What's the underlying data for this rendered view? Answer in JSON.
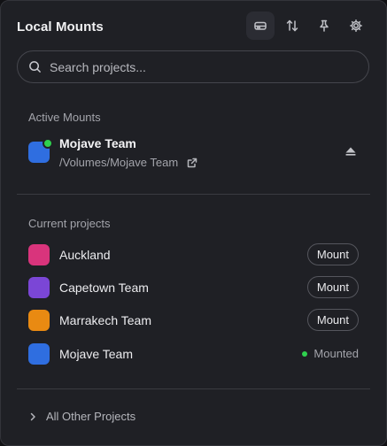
{
  "header": {
    "title": "Local Mounts",
    "icons": [
      "drive-icon",
      "sort-icon",
      "pin-icon",
      "gear-icon"
    ]
  },
  "search": {
    "placeholder": "Search projects..."
  },
  "active_mounts": {
    "label": "Active Mounts",
    "item": {
      "name": "Mojave Team",
      "path": "/Volumes/Mojave Team",
      "color": "#2f6ee0",
      "status": "mounted"
    }
  },
  "current_projects": {
    "label": "Current projects",
    "items": [
      {
        "name": "Auckland",
        "color": "#d9347c",
        "action": "Mount"
      },
      {
        "name": "Capetown Team",
        "color": "#7b46d6",
        "action": "Mount"
      },
      {
        "name": "Marrakech Team",
        "color": "#e98a12",
        "action": "Mount"
      },
      {
        "name": "Mojave Team",
        "color": "#2f6ee0",
        "status": "Mounted"
      }
    ]
  },
  "footer": {
    "label": "All Other Projects"
  },
  "colors": {
    "accent_green": "#2fd14e",
    "background": "#1f2025"
  }
}
